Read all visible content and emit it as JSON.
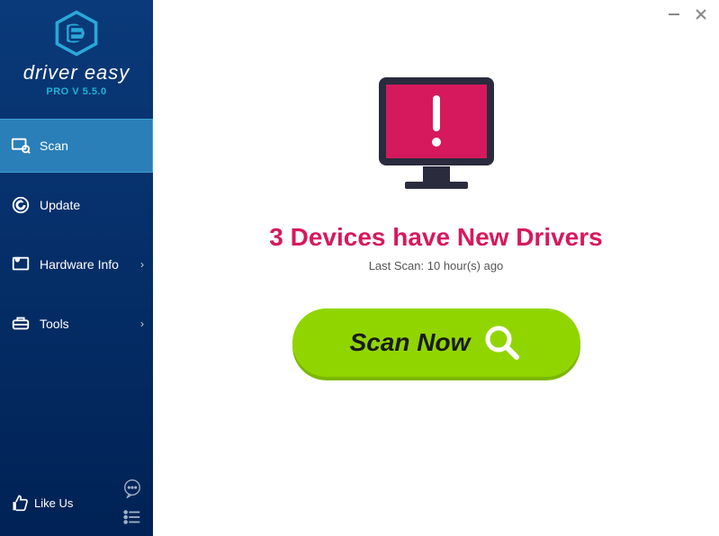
{
  "brand": {
    "name": "driver easy",
    "version": "PRO V 5.5.0"
  },
  "nav": {
    "scan": "Scan",
    "update": "Update",
    "hardware": "Hardware Info",
    "tools": "Tools"
  },
  "footer": {
    "like": "Like Us"
  },
  "main": {
    "headline": "3 Devices have New Drivers",
    "lastscan": "Last Scan: 10 hour(s) ago",
    "button": "Scan Now"
  }
}
